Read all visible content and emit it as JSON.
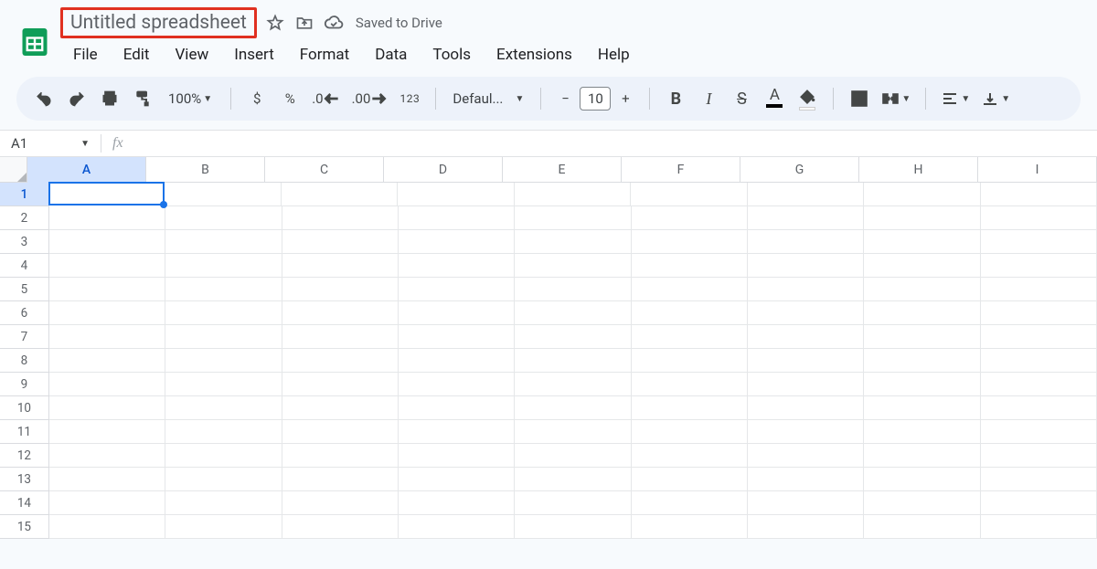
{
  "doc": {
    "title": "Untitled spreadsheet",
    "save_status": "Saved to Drive"
  },
  "menus": [
    "File",
    "Edit",
    "View",
    "Insert",
    "Format",
    "Data",
    "Tools",
    "Extensions",
    "Help"
  ],
  "toolbar": {
    "zoom": "100%",
    "currency": "$",
    "percent": "%",
    "dec_dec": ".0",
    "inc_dec": ".00",
    "num_fmt": "123",
    "font": "Defaul...",
    "font_size": "10",
    "bold": "B",
    "italic": "I",
    "strike": "S",
    "text_color_letter": "A"
  },
  "namebox": "A1",
  "columns": [
    "A",
    "B",
    "C",
    "D",
    "E",
    "F",
    "G",
    "H",
    "I"
  ],
  "rows": [
    "1",
    "2",
    "3",
    "4",
    "5",
    "6",
    "7",
    "8",
    "9",
    "10",
    "11",
    "12",
    "13",
    "14",
    "15"
  ],
  "active_cell": {
    "row": 0,
    "col": 0
  }
}
